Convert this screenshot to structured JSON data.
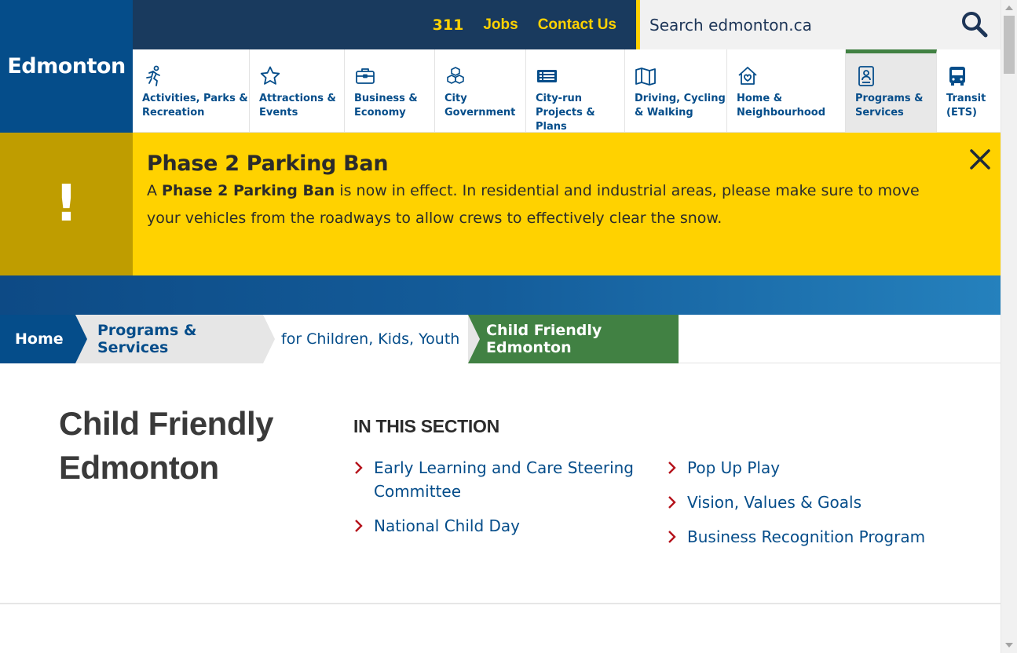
{
  "logo": {
    "text": "Edmonton",
    "icon": "edmonton-logo"
  },
  "top_links": {
    "n311": "311",
    "jobs": "Jobs",
    "contact": "Contact Us"
  },
  "search": {
    "placeholder": "Search edmonton.ca",
    "icon": "search-icon"
  },
  "nav": {
    "items": [
      {
        "label": "Activities, Parks &\nRecreation",
        "icon": "runner-icon"
      },
      {
        "label": "Attractions &\nEvents",
        "icon": "star-icon"
      },
      {
        "label": "Business &\nEconomy",
        "icon": "briefcase-icon"
      },
      {
        "label": "City\nGovernment",
        "icon": "blocks-icon"
      },
      {
        "label": "City-run\nProjects & Plans",
        "icon": "list-icon"
      },
      {
        "label": "Driving, Cycling\n& Walking",
        "icon": "map-icon"
      },
      {
        "label": "Home &\nNeighbourhood",
        "icon": "home-heart-icon"
      },
      {
        "label": "Programs &\nServices",
        "icon": "id-badge-icon"
      },
      {
        "label": "Transit\n(ETS)",
        "icon": "bus-icon"
      }
    ],
    "active_index": 7
  },
  "alert": {
    "mark": "!",
    "title": "Phase 2 Parking Ban",
    "text_prefix": "A ",
    "text_bold": "Phase 2 Parking Ban",
    "text_rest": " is now in effect. In residential and industrial areas, please make sure to move your vehicles from the roadways to allow crews to effectively clear the snow.",
    "close_icon": "close-icon"
  },
  "breadcrumb": {
    "home": "Home",
    "programs": "Programs & Services",
    "kids": "for Children, Kids, Youth",
    "current": "Child Friendly Edmonton"
  },
  "main": {
    "title": "Child Friendly Edmonton",
    "section_heading": "IN THIS SECTION",
    "links_col1": [
      "Early Learning and Care Steering Committee",
      "National Child Day"
    ],
    "links_col2": [
      "Pop Up Play",
      "Vision, Values & Goals",
      "Business Recognition Program"
    ]
  },
  "colors": {
    "brand_blue": "#054d8a",
    "navy": "#193a5e",
    "yellow": "#ffd200",
    "alert_side": "#bf9d00",
    "green": "#418143",
    "chevron": "#b5121b"
  }
}
